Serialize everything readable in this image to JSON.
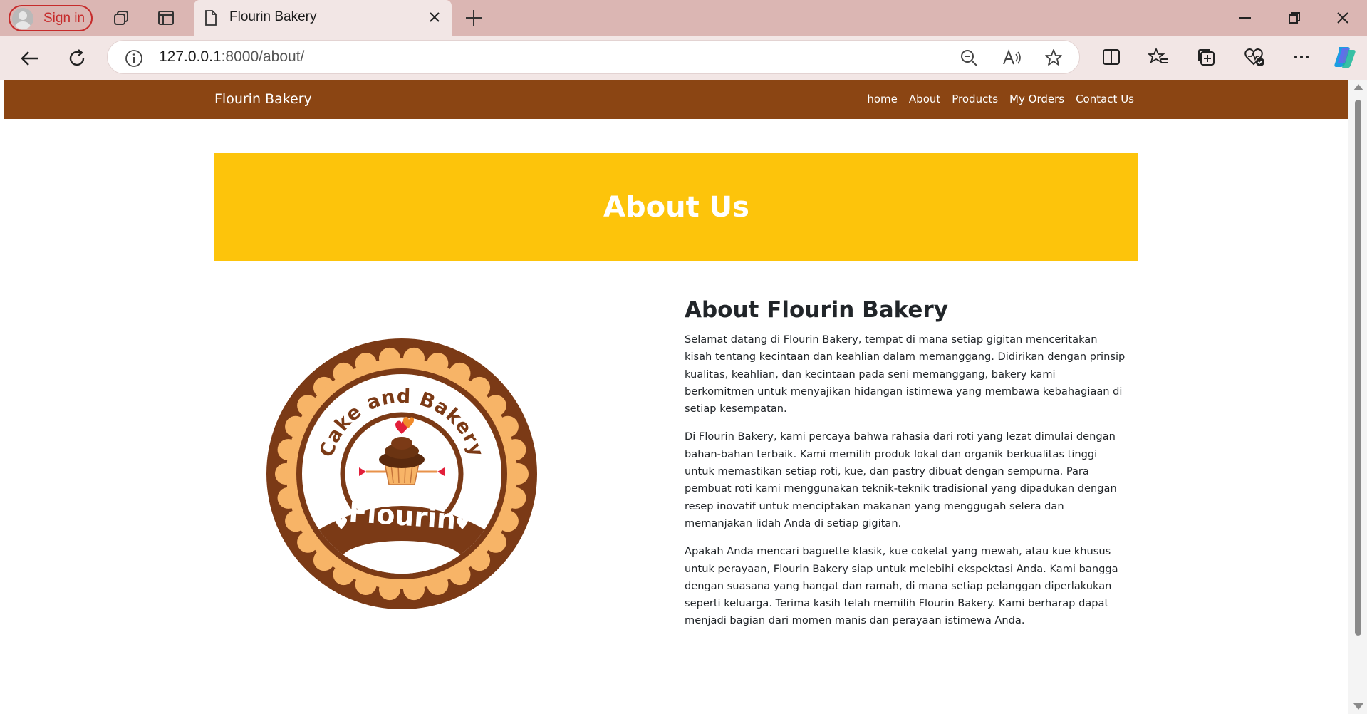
{
  "browser": {
    "signin_label": "Sign in",
    "tab_title": "Flourin Bakery",
    "url_host": "127.0.0.1",
    "url_path": ":8000/about/"
  },
  "site": {
    "brand": "Flourin Bakery",
    "nav": [
      "home",
      "About",
      "Products",
      "My Orders",
      "Contact Us"
    ],
    "hero_title": "About Us",
    "logo": {
      "top_text": "Cake and Bakery",
      "banner_text": "Flourin"
    },
    "about": {
      "heading": "About Flourin Bakery",
      "paragraphs": [
        "Selamat datang di Flourin Bakery, tempat di mana setiap gigitan menceritakan kisah tentang kecintaan dan keahlian dalam memanggang. Didirikan dengan prinsip kualitas, keahlian, dan kecintaan pada seni memanggang, bakery kami berkomitmen untuk menyajikan hidangan istimewa yang membawa kebahagiaan di setiap kesempatan.",
        "Di Flourin Bakery, kami percaya bahwa rahasia dari roti yang lezat dimulai dengan bahan-bahan terbaik. Kami memilih produk lokal dan organik berkualitas tinggi untuk memastikan setiap roti, kue, dan pastry dibuat dengan sempurna. Para pembuat roti kami menggunakan teknik-teknik tradisional yang dipadukan dengan resep inovatif untuk menciptakan makanan yang menggugah selera dan memanjakan lidah Anda di setiap gigitan.",
        "Apakah Anda mencari baguette klasik, kue cokelat yang mewah, atau kue khusus untuk perayaan, Flourin Bakery siap untuk melebihi ekspektasi Anda. Kami bangga dengan suasana yang hangat dan ramah, di mana setiap pelanggan diperlakukan seperti keluarga. Terima kasih telah memilih Flourin Bakery. Kami berharap dapat menjadi bagian dari momen manis dan perayaan istimewa Anda."
      ]
    }
  },
  "colors": {
    "navbar": "#8b4513",
    "hero": "#fdc40b",
    "logo_brown": "#7b3a16",
    "logo_peach": "#f7b467"
  }
}
